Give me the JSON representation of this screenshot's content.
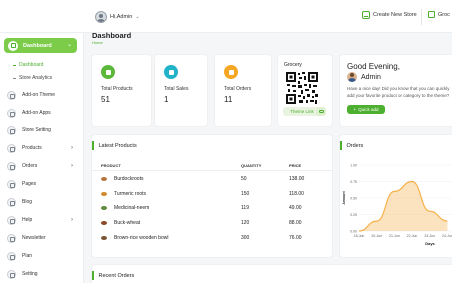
{
  "topbar": {
    "user_name": "Hi,Admin",
    "create_store_label": "Create New Store",
    "store_label": "Groc"
  },
  "sidebar": {
    "active": "Dashboard",
    "sub_items": [
      "Dashboard",
      "Store Analytics"
    ],
    "items": [
      {
        "label": "Add-on Theme",
        "icon": "theme-icon",
        "has_chevron": false
      },
      {
        "label": "Add-on Apps",
        "icon": "apps-icon",
        "has_chevron": false
      },
      {
        "label": "Store Setting",
        "icon": "settings-icon",
        "has_chevron": false
      },
      {
        "label": "Products",
        "icon": "products-icon",
        "has_chevron": true
      },
      {
        "label": "Orders",
        "icon": "orders-icon",
        "has_chevron": true
      },
      {
        "label": "Pages",
        "icon": "pages-icon",
        "has_chevron": false
      },
      {
        "label": "Blog",
        "icon": "blog-icon",
        "has_chevron": false
      },
      {
        "label": "Help",
        "icon": "help-icon",
        "has_chevron": true
      },
      {
        "label": "Newsletter",
        "icon": "newsletter-icon",
        "has_chevron": false
      },
      {
        "label": "Plan",
        "icon": "plan-icon",
        "has_chevron": false
      },
      {
        "label": "Setting",
        "icon": "gear-icon",
        "has_chevron": false
      }
    ]
  },
  "page": {
    "title": "Dashboard",
    "breadcrumb": "Home"
  },
  "stats": [
    {
      "label": "Total Products",
      "value": "51",
      "color": "#5cb83a"
    },
    {
      "label": "Total Sales",
      "value": "1",
      "color": "#20b2c8"
    },
    {
      "label": "Total Orders",
      "value": "11",
      "color": "#f5a623"
    }
  ],
  "qr_card": {
    "title": "Grocery",
    "link_label": "Theme Link"
  },
  "greeting": {
    "line1": "Good Evening,",
    "name": "Admin",
    "message": "Have a nice day! Did you know that you can quickly add your favorite product or category to the theme?",
    "quick_add_label": "Quick add"
  },
  "latest_products": {
    "title": "Latest Products",
    "columns": [
      "PRODUCT",
      "QUANTITY",
      "PRICE"
    ],
    "rows": [
      {
        "name": "Burdockroots",
        "quantity": "50",
        "price": "138.00",
        "color": "#b5763d"
      },
      {
        "name": "Turmeric roots",
        "quantity": "150",
        "price": "118.00",
        "color": "#d08a2a"
      },
      {
        "name": "Medicinal-neem",
        "quantity": "119",
        "price": "49.00",
        "color": "#5e8a3a"
      },
      {
        "name": "Buck-wheat",
        "quantity": "120",
        "price": "88.00",
        "color": "#8a4a2a"
      },
      {
        "name": "Brown-rice wooden bowl",
        "quantity": "300",
        "price": "76.00",
        "color": "#7a5535"
      }
    ]
  },
  "orders_chart": {
    "title": "Orders",
    "chart_data": {
      "type": "area",
      "x": [
        "18-Jun",
        "20-Jun",
        "21-Jun",
        "22-Jun",
        "23-Jun",
        "24-Jun"
      ],
      "values": [
        0,
        0.15,
        0.6,
        0.75,
        0.3,
        0.15
      ],
      "ylabel": "Amount",
      "xlabel": "Days",
      "yticks": [
        "0.00",
        "0.25",
        "0.50",
        "0.75",
        "1.00"
      ],
      "ylim": [
        0,
        1
      ],
      "color": "#f5b04a"
    }
  },
  "recent_orders": {
    "title": "Recent Orders"
  }
}
